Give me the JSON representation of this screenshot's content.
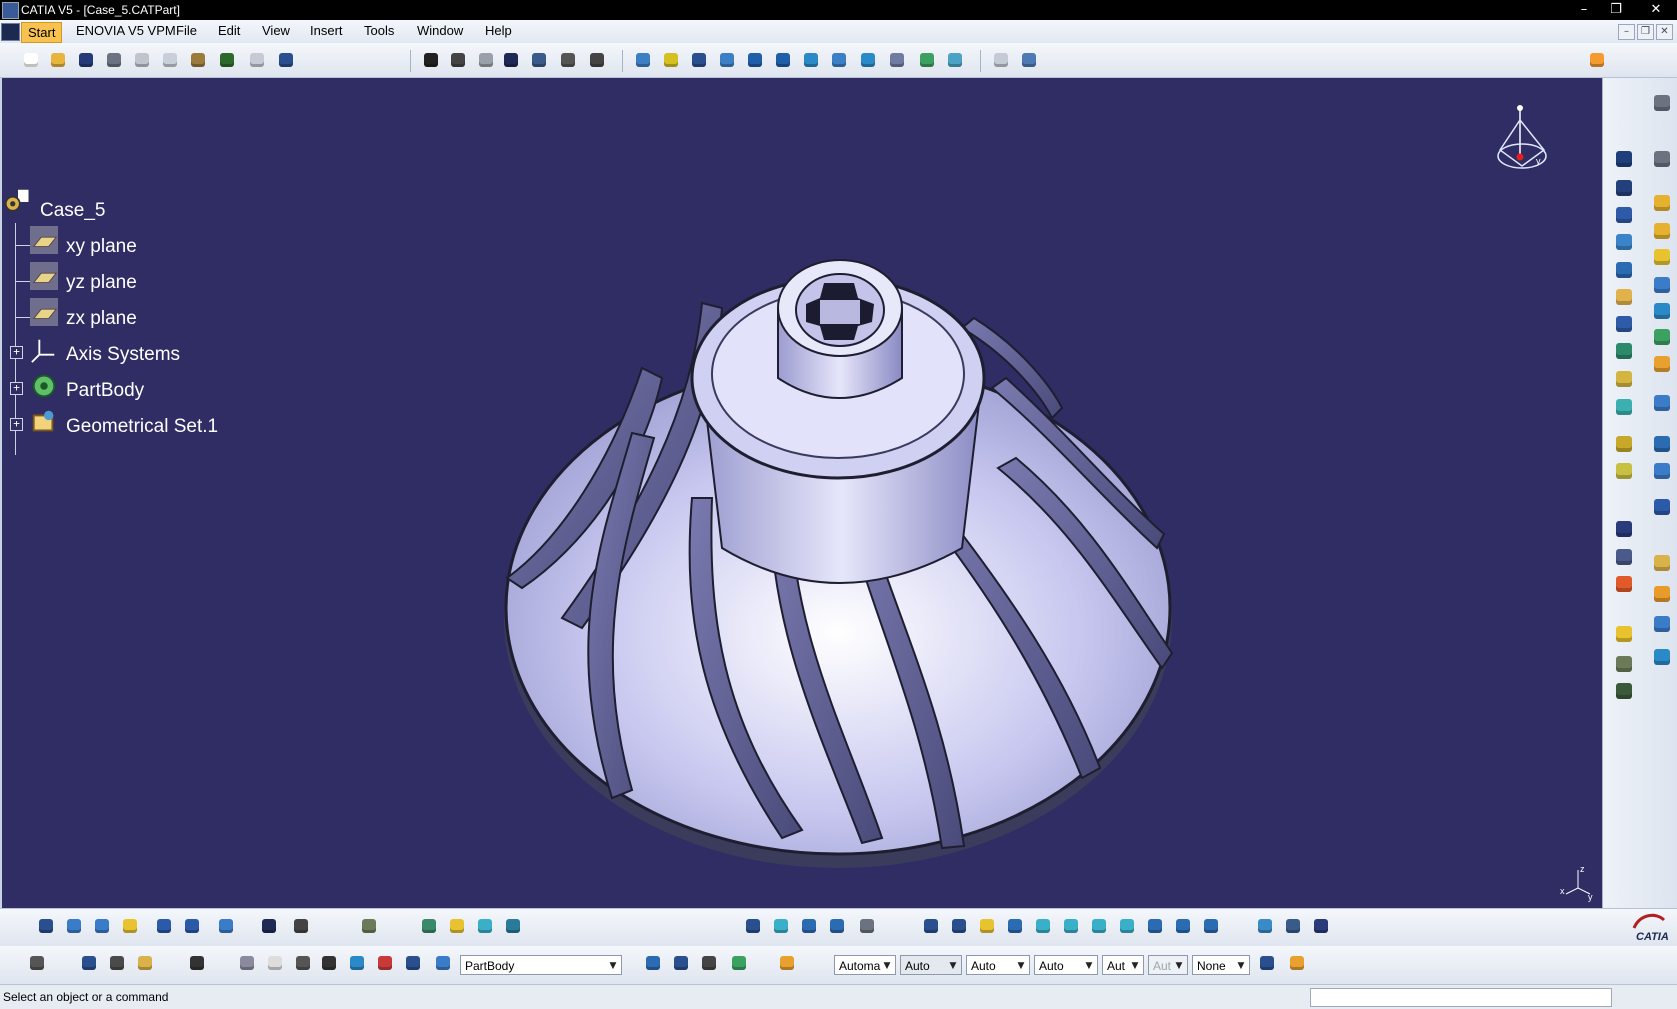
{
  "window": {
    "title": "CATIA V5 - [Case_5.CATPart]",
    "controls": {
      "minimize": "–",
      "maximize": "❐",
      "close": "✕"
    },
    "doc_controls": {
      "minimize": "–",
      "restore": "❐",
      "close": "✕"
    }
  },
  "menubar": {
    "items": [
      {
        "label": "Start"
      },
      {
        "label": "ENOVIA V5 VPM"
      },
      {
        "label": "File"
      },
      {
        "label": "Edit"
      },
      {
        "label": "View"
      },
      {
        "label": "Insert"
      },
      {
        "label": "Tools"
      },
      {
        "label": "Window"
      },
      {
        "label": "Help"
      }
    ]
  },
  "tree": {
    "root": "Case_5",
    "nodes": [
      {
        "label": "xy plane",
        "icon": "plane-icon",
        "expandable": false
      },
      {
        "label": "yz plane",
        "icon": "plane-icon",
        "expandable": false
      },
      {
        "label": "zx plane",
        "icon": "plane-icon",
        "expandable": false
      },
      {
        "label": "Axis Systems",
        "icon": "axis-system-icon",
        "expandable": true
      },
      {
        "label": "PartBody",
        "icon": "partbody-gear-icon",
        "expandable": true
      },
      {
        "label": "Geometrical Set.1",
        "icon": "geometrical-set-icon",
        "expandable": true
      }
    ]
  },
  "viewport": {
    "background": "#2f2d64",
    "model": "impeller",
    "model_color": "#c9c9f0"
  },
  "bottom_toolbar": {
    "current_body": "PartBody",
    "graphic_props": [
      {
        "value": "Automa",
        "enabled": true
      },
      {
        "value": "Auto",
        "enabled": true
      },
      {
        "value": "Auto",
        "enabled": true
      },
      {
        "value": "Auto",
        "enabled": true
      },
      {
        "value": "Aut",
        "enabled": true
      },
      {
        "value": "Aut",
        "enabled": false
      },
      {
        "value": "None",
        "enabled": true
      }
    ]
  },
  "compass": {
    "axis_x": "x",
    "axis_y": "y",
    "axis_z": "z"
  },
  "triad": {
    "x": "x",
    "y": "y",
    "z": "z"
  },
  "brand": {
    "logo_text": "CATIA"
  },
  "status": {
    "message": "Select an object or a command"
  },
  "colors": {
    "accent": "#f7c24f",
    "viewport": "#2f2d64",
    "toolbar": "#e6ebf3"
  }
}
